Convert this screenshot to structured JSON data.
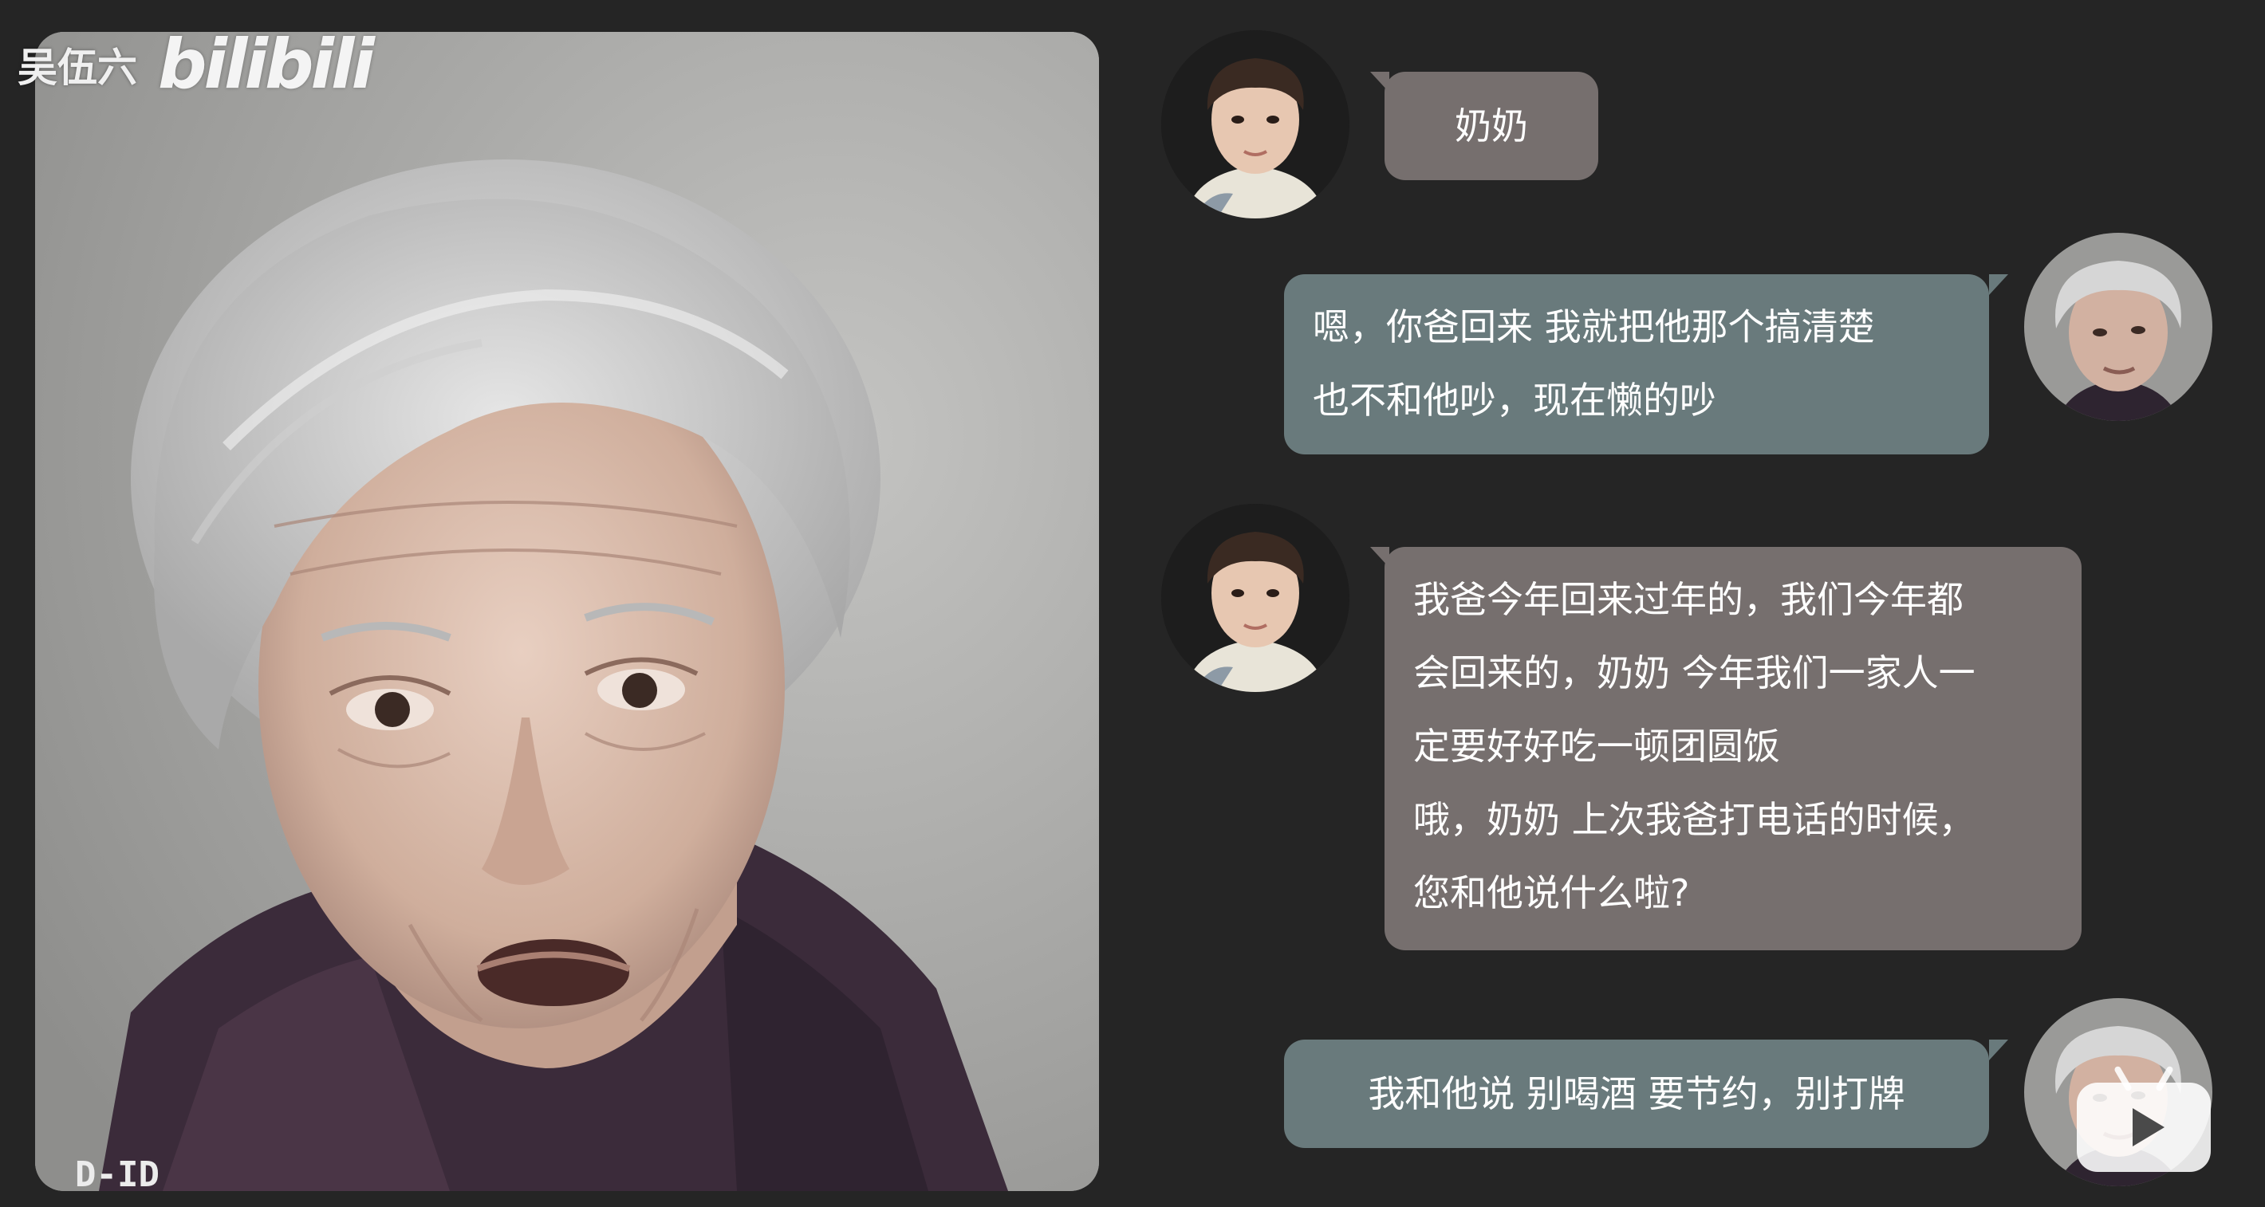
{
  "watermark": {
    "author": "吴伍六",
    "site": "bilibili"
  },
  "video": {
    "logo": "D-ID"
  },
  "messages": [
    {
      "sender": "grandson",
      "lines": [
        "奶奶"
      ]
    },
    {
      "sender": "grandma",
      "lines": [
        "嗯，你爸回来  我就把他那个搞清楚",
        "也不和他吵，现在懒的吵"
      ]
    },
    {
      "sender": "grandson",
      "lines": [
        "我爸今年回来过年的，我们今年都",
        "会回来的，奶奶 今年我们一家人一",
        "定要好好吃一顿团圆饭",
        "哦，奶奶  上次我爸打电话的时候，",
        "您和他说什么啦?"
      ]
    },
    {
      "sender": "grandma",
      "lines": [
        "我和他说  别喝酒  要节约，别打牌"
      ]
    }
  ],
  "icons": {
    "corner_logo": "bilibili-tv-icon",
    "avatar_grandson": "young-man-avatar",
    "avatar_grandma": "elderly-woman-avatar"
  },
  "colors": {
    "background": "#252525",
    "grandson_bubble": "#766f6e",
    "grandma_bubble": "#697a7c",
    "text": "#ffffff"
  }
}
